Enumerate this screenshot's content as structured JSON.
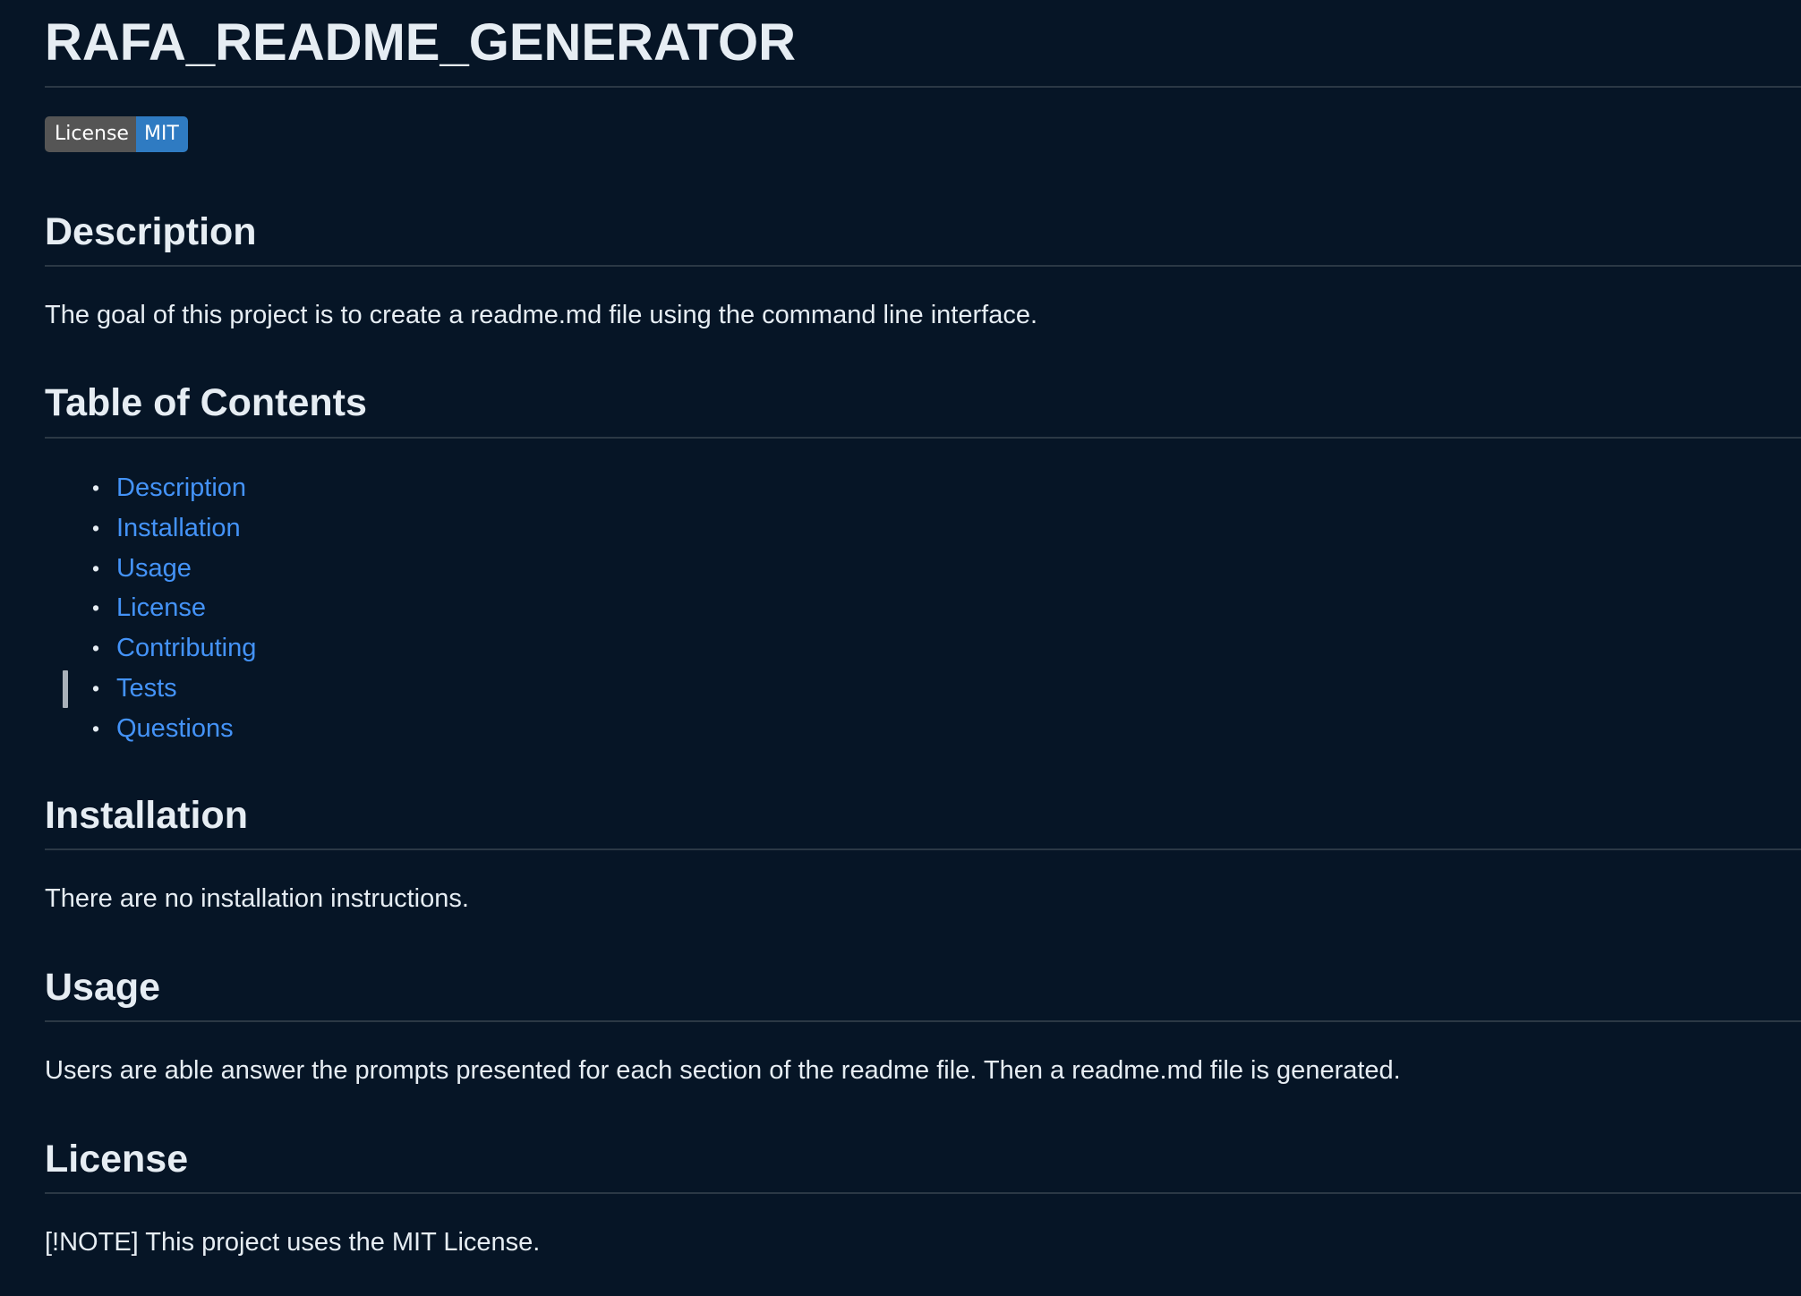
{
  "readme": {
    "title": "RAFA_README_GENERATOR",
    "badge": {
      "label": "License",
      "value": "MIT",
      "colors": {
        "label_bg": "#555555",
        "value_bg": "#2f7bc2"
      }
    },
    "sections": {
      "description": {
        "heading": "Description",
        "text": "The goal of this project is to create a readme.md file using the command line interface."
      },
      "toc": {
        "heading": "Table of Contents",
        "items": [
          "Description",
          "Installation",
          "Usage",
          "License",
          "Contributing",
          "Tests",
          "Questions"
        ]
      },
      "installation": {
        "heading": "Installation",
        "text": "There are no installation instructions."
      },
      "usage": {
        "heading": "Usage",
        "text": "Users are able answer the prompts presented for each section of the readme file. Then a readme.md file is generated."
      },
      "license": {
        "heading": "License",
        "text": "[!NOTE] This project uses the MIT License."
      }
    }
  },
  "theme": {
    "background": "#061526",
    "text": "#e6edf3",
    "link": "#4493f8",
    "divider": "#2b3845"
  }
}
